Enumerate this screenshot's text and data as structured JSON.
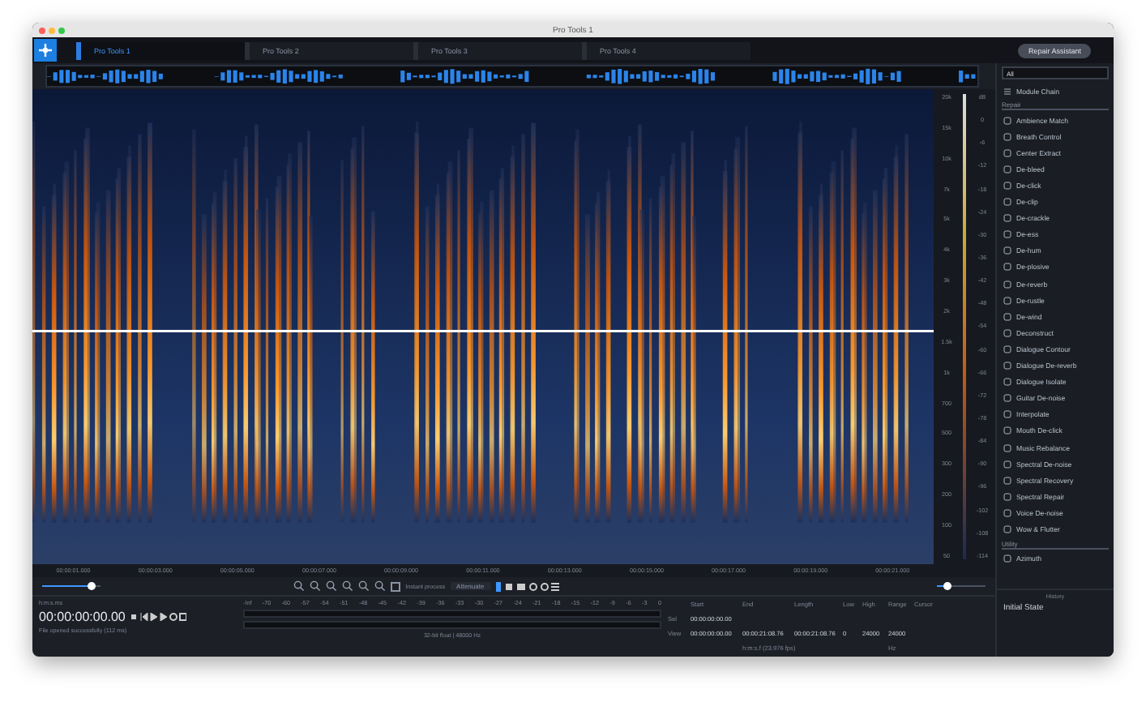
{
  "window": {
    "title": "Pro Tools 1"
  },
  "tabs": [
    {
      "label": "Pro Tools 1",
      "selected": true
    },
    {
      "label": "Pro Tools 2",
      "selected": false
    },
    {
      "label": "Pro Tools 3",
      "selected": false
    },
    {
      "label": "Pro Tools 4",
      "selected": false
    }
  ],
  "repair_assistant_button": "Repair Assistant",
  "time_ruler": [
    "00:00:01.000",
    "00:00:03.000",
    "00:00:05.000",
    "00:00:07.000",
    "00:00:09.000",
    "00:00:11.000",
    "00:00:13.000",
    "00:00:15.000",
    "00:00:17.000",
    "00:00:19.000",
    "00:00:21.000"
  ],
  "frequency_scale": [
    "20k",
    "15k",
    "10k",
    "7k",
    "5k",
    "4k",
    "3k",
    "2k",
    "1.5k",
    "1k",
    "700",
    "500",
    "300",
    "200",
    "100",
    "50"
  ],
  "meter_scale": [
    "dB",
    "0",
    "-6",
    "-12",
    "-18",
    "-24",
    "-30",
    "-36",
    "-42",
    "-48",
    "-54",
    "-60",
    "-66",
    "-72",
    "-78",
    "-84",
    "-90",
    "-96",
    "-102",
    "-108",
    "-114"
  ],
  "playhead_volume": {
    "level": 0.85
  },
  "zoom_toolbar": {
    "instant_process": {
      "label": "Instant process",
      "checked": false
    },
    "mode": "Attenuate"
  },
  "zoom_slider": {
    "level": 0.2
  },
  "module_panel": {
    "filter": "All",
    "chain": "Module Chain",
    "groups": [
      {
        "label": "Repair",
        "items": [
          "Ambience Match",
          "Breath Control",
          "Center Extract",
          "De-bleed",
          "De-click",
          "De-clip",
          "De-crackle",
          "De-ess",
          "De-hum",
          "De-plosive",
          "De-reverb",
          "De-rustle",
          "De-wind",
          "Deconstruct",
          "Dialogue Contour",
          "Dialogue De-reverb",
          "Dialogue Isolate",
          "Guitar De-noise",
          "Interpolate",
          "Mouth De-click",
          "Music Rebalance",
          "Spectral De-noise",
          "Spectral Recovery",
          "Spectral Repair",
          "Voice De-noise",
          "Wow & Flutter"
        ]
      },
      {
        "label": "Utility",
        "items": [
          "Azimuth"
        ]
      }
    ]
  },
  "history": {
    "title": "History",
    "items": [
      "Initial State"
    ]
  },
  "transport": {
    "format": "h:m:s.ms",
    "time": "00:00:00:00.00",
    "status": "File opened successfully (112 ms)"
  },
  "level_meter": {
    "scale": [
      "-Inf",
      "-70",
      "-60",
      "-57",
      "-54",
      "-51",
      "-48",
      "-45",
      "-42",
      "-39",
      "-36",
      "-33",
      "-30",
      "-27",
      "-24",
      "-21",
      "-18",
      "-15",
      "-12",
      "-9",
      "-6",
      "-3",
      "0"
    ],
    "info": "32-bit float | 48000 Hz"
  },
  "selection": {
    "columns": [
      "Start",
      "End",
      "Length",
      "Low",
      "High",
      "Range",
      "Cursor"
    ],
    "rows": [
      {
        "label": "Sel",
        "cells": [
          "00:00:00:00.00",
          "",
          "",
          "",
          "",
          "",
          ""
        ]
      },
      {
        "label": "View",
        "cells": [
          "00:00:00:00.00",
          "00:00:21:08.76",
          "00:00:21:08.76",
          "0",
          "24000",
          "24000",
          ""
        ]
      }
    ],
    "time_unit": "h:m:s.f (23.976 fps)",
    "freq_unit": "Hz"
  }
}
